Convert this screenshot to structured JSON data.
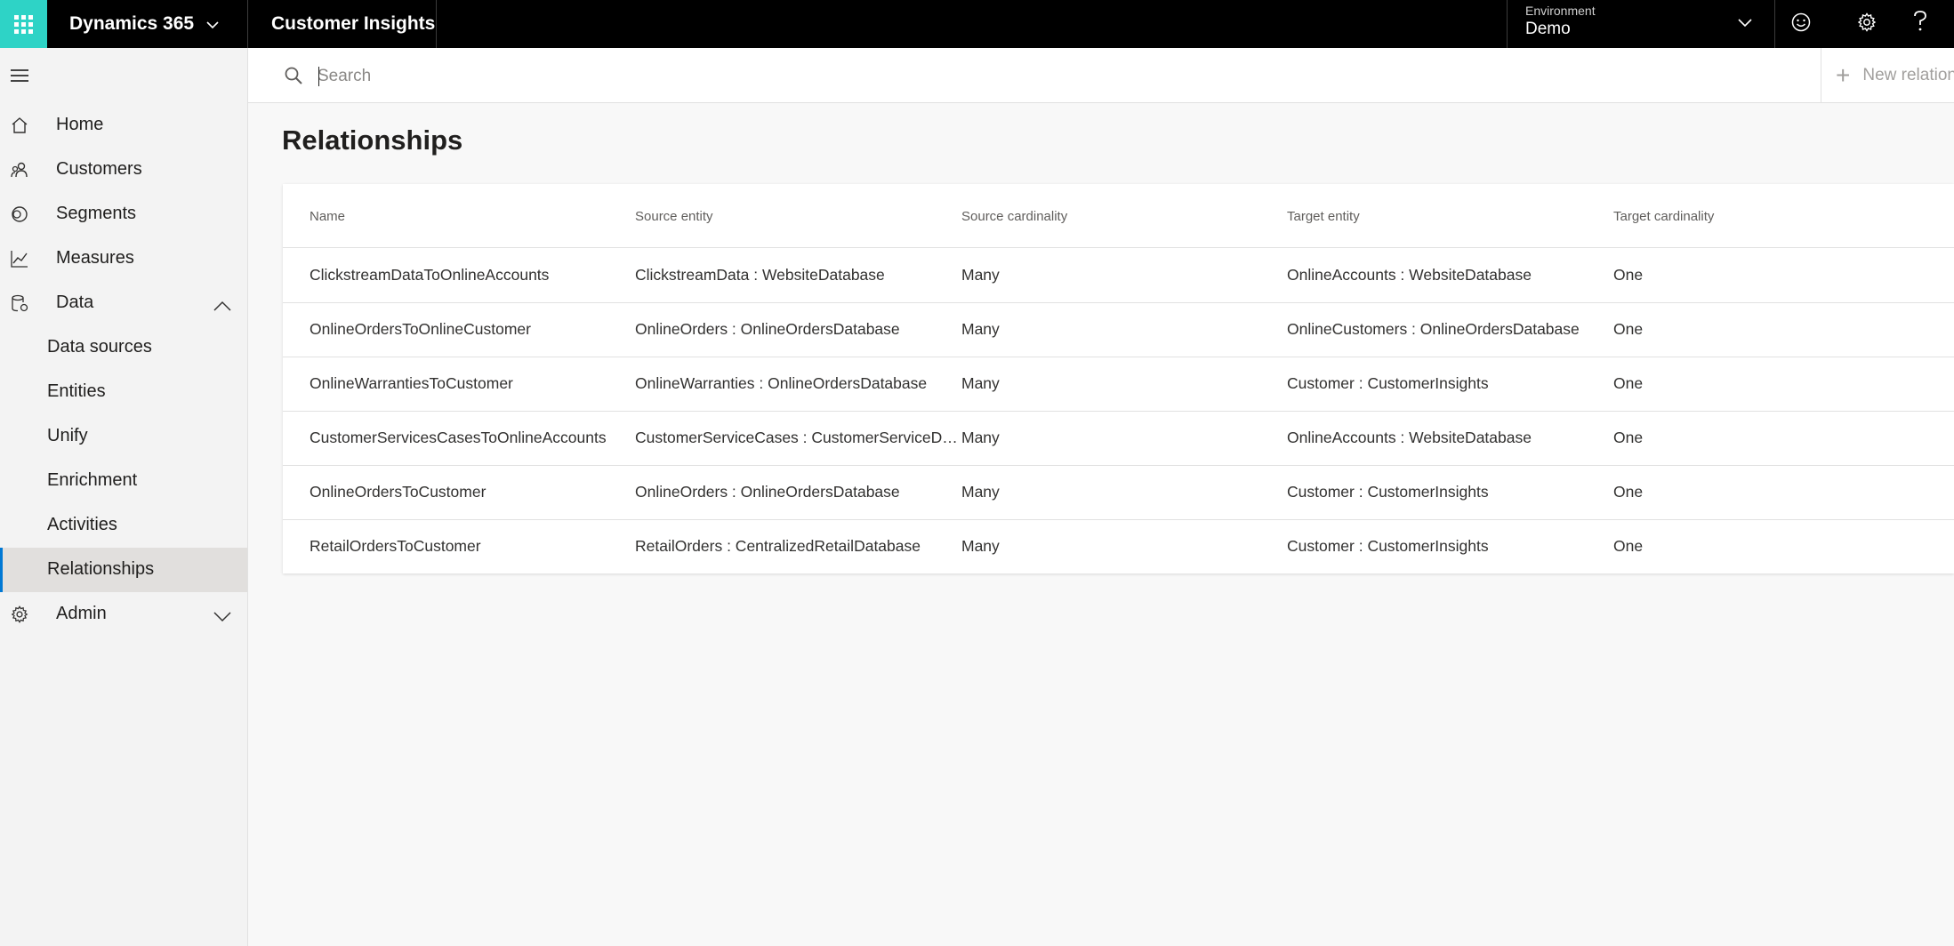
{
  "topbar": {
    "brand": "Dynamics 365",
    "app_name": "Customer Insights",
    "environment_label": "Environment",
    "environment_value": "Demo",
    "icons": [
      "waffle-icon",
      "chevron-down-icon",
      "smiley-icon",
      "gear-icon",
      "help-icon"
    ]
  },
  "sidebar": {
    "items": [
      {
        "label": "Home",
        "icon": "home-icon"
      },
      {
        "label": "Customers",
        "icon": "people-icon"
      },
      {
        "label": "Segments",
        "icon": "segments-icon"
      },
      {
        "label": "Measures",
        "icon": "chart-icon"
      },
      {
        "label": "Data",
        "icon": "database-icon"
      },
      {
        "label": "Data sources"
      },
      {
        "label": "Entities"
      },
      {
        "label": "Unify"
      },
      {
        "label": "Enrichment"
      },
      {
        "label": "Activities"
      },
      {
        "label": "Relationships",
        "selected": true
      },
      {
        "label": "Admin",
        "icon": "gear-icon"
      }
    ]
  },
  "command_bar": {
    "search_placeholder": "Search",
    "new_button_label": "New relation"
  },
  "page": {
    "title": "Relationships"
  },
  "table": {
    "columns": [
      "Name",
      "Source entity",
      "Source cardinality",
      "Target entity",
      "Target cardinality"
    ],
    "rows": [
      {
        "name": "ClickstreamDataToOnlineAccounts",
        "source": "ClickstreamData : WebsiteDatabase",
        "source_card": "Many",
        "target": "OnlineAccounts : WebsiteDatabase",
        "target_card": "One"
      },
      {
        "name": "OnlineOrdersToOnlineCustomer",
        "source": "OnlineOrders : OnlineOrdersDatabase",
        "source_card": "Many",
        "target": "OnlineCustomers : OnlineOrdersDatabase",
        "target_card": "One"
      },
      {
        "name": "OnlineWarrantiesToCustomer",
        "source": "OnlineWarranties : OnlineOrdersDatabase",
        "source_card": "Many",
        "target": "Customer : CustomerInsights",
        "target_card": "One"
      },
      {
        "name": "CustomerServicesCasesToOnlineAccounts",
        "source": "CustomerServiceCases : CustomerServiceDatabase",
        "source_card": "Many",
        "target": "OnlineAccounts : WebsiteDatabase",
        "target_card": "One"
      },
      {
        "name": "OnlineOrdersToCustomer",
        "source": "OnlineOrders : OnlineOrdersDatabase",
        "source_card": "Many",
        "target": "Customer : CustomerInsights",
        "target_card": "One"
      },
      {
        "name": "RetailOrdersToCustomer",
        "source": "RetailOrders : CentralizedRetailDatabase",
        "source_card": "Many",
        "target": "Customer : CustomerInsights",
        "target_card": "One"
      }
    ]
  },
  "colors": {
    "accent": "#0078d4",
    "waffle": "#2ed3c6",
    "topbar": "#000000"
  }
}
